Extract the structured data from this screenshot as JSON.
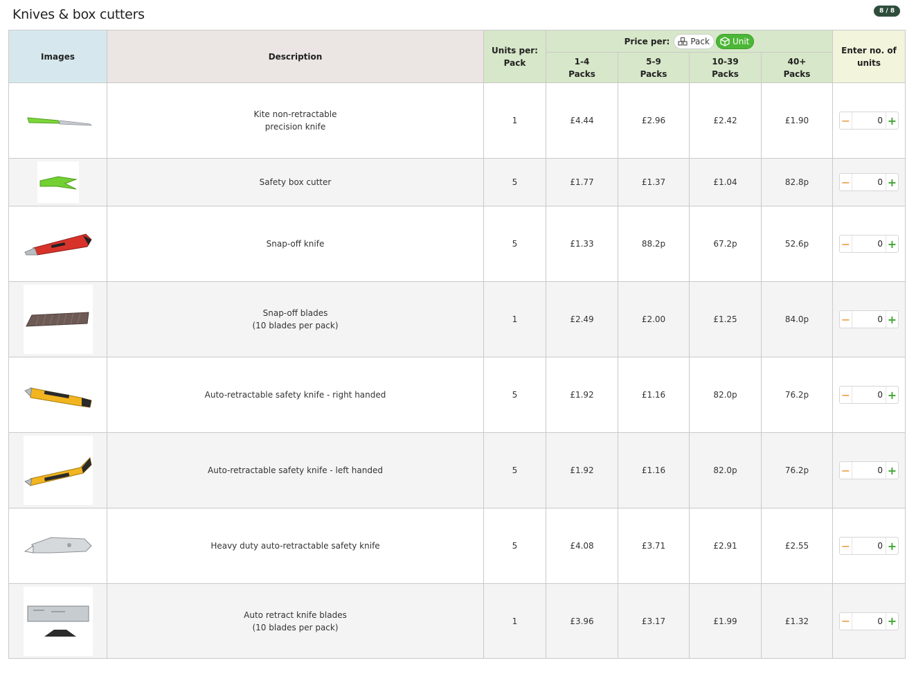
{
  "page": {
    "title": "Knives & box cutters",
    "badge": "8 / 8"
  },
  "table": {
    "headers": {
      "images": "Images",
      "description": "Description",
      "units_per_pack_line1": "Units per:",
      "units_per_pack_line2": "Pack",
      "price_per": "Price per:",
      "toggle_pack": "Pack",
      "toggle_unit": "Unit",
      "enter_line1": "Enter no. of",
      "enter_line2": "units",
      "tiers": [
        {
          "line1": "1-4",
          "line2": "Packs"
        },
        {
          "line1": "5-9",
          "line2": "Packs"
        },
        {
          "line1": "10-39",
          "line2": "Packs"
        },
        {
          "line1": "40+",
          "line2": "Packs"
        }
      ]
    },
    "selected_price_mode": "Unit",
    "rows": [
      {
        "desc1": "Kite non-retractable",
        "desc2": "precision knife",
        "units": "1",
        "p1": "£4.44",
        "p2": "£2.96",
        "p3": "£2.42",
        "p4": "£1.90",
        "qty": "0",
        "icon": "precision-knife-image"
      },
      {
        "desc1": "Safety box cutter",
        "desc2": "",
        "units": "5",
        "p1": "£1.77",
        "p2": "£1.37",
        "p3": "£1.04",
        "p4": "82.8p",
        "qty": "0",
        "icon": "box-cutter-image"
      },
      {
        "desc1": "Snap-off knife",
        "desc2": "",
        "units": "5",
        "p1": "£1.33",
        "p2": "88.2p",
        "p3": "67.2p",
        "p4": "52.6p",
        "qty": "0",
        "icon": "snap-off-knife-image"
      },
      {
        "desc1": "Snap-off blades",
        "desc2": "(10 blades per pack)",
        "units": "1",
        "p1": "£2.49",
        "p2": "£2.00",
        "p3": "£1.25",
        "p4": "84.0p",
        "qty": "0",
        "icon": "snap-off-blade-image"
      },
      {
        "desc1": "Auto-retractable safety knife - right handed",
        "desc2": "",
        "units": "5",
        "p1": "£1.92",
        "p2": "£1.16",
        "p3": "82.0p",
        "p4": "76.2p",
        "qty": "0",
        "icon": "safety-knife-right-image"
      },
      {
        "desc1": "Auto-retractable safety knife - left handed",
        "desc2": "",
        "units": "5",
        "p1": "£1.92",
        "p2": "£1.16",
        "p3": "82.0p",
        "p4": "76.2p",
        "qty": "0",
        "icon": "safety-knife-left-image"
      },
      {
        "desc1": "Heavy duty auto-retractable safety knife",
        "desc2": "",
        "units": "5",
        "p1": "£4.08",
        "p2": "£3.71",
        "p3": "£2.91",
        "p4": "£2.55",
        "qty": "0",
        "icon": "heavy-duty-knife-image"
      },
      {
        "desc1": "Auto retract knife blades",
        "desc2": "(10 blades per pack)",
        "units": "1",
        "p1": "£3.96",
        "p2": "£3.17",
        "p3": "£1.99",
        "p4": "£1.32",
        "qty": "0",
        "icon": "knife-blades-image"
      }
    ]
  },
  "colors": {
    "unit_toggle": "#4cb637",
    "minus": "#e48a1b",
    "plus": "#3ea531",
    "badge": "#2f4d3c"
  }
}
